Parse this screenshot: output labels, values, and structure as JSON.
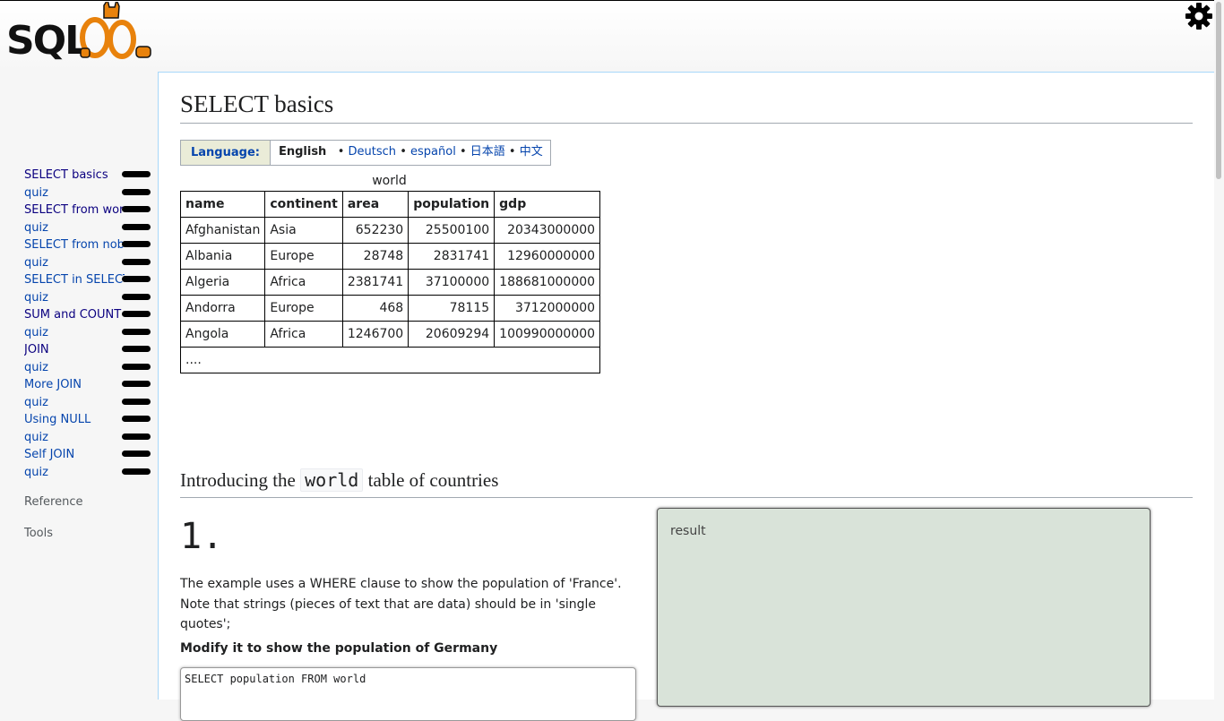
{
  "logo_text": "SQLZOO",
  "sidebar": {
    "items": [
      {
        "label": "SELECT basics",
        "visited": true
      },
      {
        "label": "quiz",
        "visited": false
      },
      {
        "label": "SELECT from world",
        "visited": true
      },
      {
        "label": "quiz",
        "visited": false
      },
      {
        "label": "SELECT from nobel",
        "visited": false
      },
      {
        "label": "quiz",
        "visited": false
      },
      {
        "label": "SELECT in SELECT",
        "visited": false
      },
      {
        "label": "quiz",
        "visited": false
      },
      {
        "label": "SUM and COUNT",
        "visited": true
      },
      {
        "label": "quiz",
        "visited": false
      },
      {
        "label": "JOIN",
        "visited": true
      },
      {
        "label": "quiz",
        "visited": false
      },
      {
        "label": "More JOIN",
        "visited": false
      },
      {
        "label": "quiz",
        "visited": false
      },
      {
        "label": "Using NULL",
        "visited": false
      },
      {
        "label": "quiz",
        "visited": false
      },
      {
        "label": "Self JOIN",
        "visited": false
      },
      {
        "label": "quiz",
        "visited": false
      }
    ],
    "reference_label": "Reference",
    "tools_label": "Tools"
  },
  "page_title": "SELECT basics",
  "language": {
    "label": "Language:",
    "current": "English",
    "others": [
      "Deutsch",
      "español",
      "日本語",
      "中文"
    ]
  },
  "world_table": {
    "caption": "world",
    "headers": [
      "name",
      "continent",
      "area",
      "population",
      "gdp"
    ],
    "rows": [
      [
        "Afghanistan",
        "Asia",
        "652230",
        "25500100",
        "20343000000"
      ],
      [
        "Albania",
        "Europe",
        "28748",
        "2831741",
        "12960000000"
      ],
      [
        "Algeria",
        "Africa",
        "2381741",
        "37100000",
        "188681000000"
      ],
      [
        "Andorra",
        "Europe",
        "468",
        "78115",
        "3712000000"
      ],
      [
        "Angola",
        "Africa",
        "1246700",
        "20609294",
        "100990000000"
      ]
    ],
    "ellipsis": "...."
  },
  "section": {
    "title_before": "Introducing the",
    "title_code": "world",
    "title_after": "table of countries"
  },
  "question": {
    "number": "1.",
    "text": "The example uses a WHERE clause to show the population of 'France'. Note that strings (pieces of text that are data) should be in 'single quotes';",
    "task": "Modify it to show the population of Germany",
    "sql": "SELECT population FROM world"
  },
  "result_label": "result",
  "colors": {
    "link": "#0645ad",
    "link_visited": "#0b0080",
    "result_bg": "#d9e3d9",
    "logo_orange": "#e8820c"
  },
  "icons": {
    "settings": "gear-icon"
  }
}
